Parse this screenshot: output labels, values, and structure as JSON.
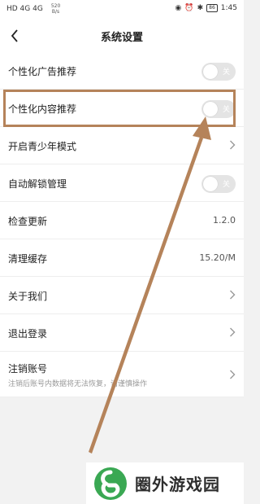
{
  "status_bar": {
    "carrier": "HD 4G 4G",
    "net_speed": "520",
    "net_unit": "B/s",
    "battery": "86",
    "time": "1:45"
  },
  "header": {
    "title": "系统设置"
  },
  "settings": [
    {
      "label": "个性化广告推荐",
      "toggle": "关"
    },
    {
      "label": "个性化内容推荐",
      "toggle": "关"
    },
    {
      "label": "开启青少年模式"
    },
    {
      "label": "自动解锁管理",
      "toggle": "关"
    },
    {
      "label": "检查更新",
      "value": "1.2.0"
    },
    {
      "label": "清理缓存",
      "value": "15.20/M"
    },
    {
      "label": "关于我们"
    },
    {
      "label": "退出登录"
    },
    {
      "label": "注销账号",
      "sub": "注销后账号内数据将无法恢复，请谨慎操作"
    }
  ],
  "watermark": {
    "text": "圈外游戏园"
  },
  "colors": {
    "highlight": "#b5835a",
    "arrow": "#b5835a",
    "logo": "#3aa853"
  }
}
